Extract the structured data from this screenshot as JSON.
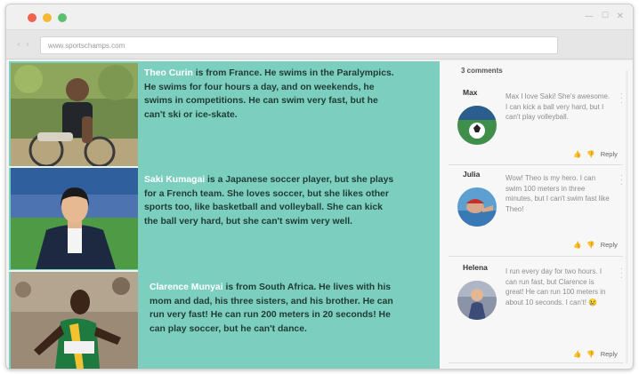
{
  "browser": {
    "url": "www.sportschamps.com",
    "nav_glyph": "‹ ›",
    "min_glyph": "—",
    "max_glyph": "☐",
    "close_glyph": "✕"
  },
  "athletes": [
    {
      "name": "Theo Curin",
      "bio": " is from France. He swims in the Paralympics. He swims for four hours a day, and on weekends, he swims in competitions. He can swim very fast, but he can't ski or ice-skate."
    },
    {
      "name": "Saki Kumagai",
      "bio": " is a Japanese soccer player, but she plays for a French team. She loves soccer, but she likes other sports too, like basketball and volleyball. She can kick the ball very hard, but she can't swim very well."
    },
    {
      "name": "Clarence Munyai",
      "bio": " is from South Africa. He lives with his mom and dad, his three sisters, and his brother. He can run very fast! He can run 200 meters in 20 seconds! He can play soccer, but he can't dance."
    }
  ],
  "comments_header": "3 comments",
  "comments": [
    {
      "author": "Max",
      "text": "Max I love Saki! She's awesome. I can kick a ball very hard, but I can't play volleyball.",
      "reply_label": "Reply"
    },
    {
      "author": "Julia",
      "text": "Wow! Theo is my hero. I can swim 100 meters in three minutes, but I can't swim fast like Theo!",
      "reply_label": "Reply"
    },
    {
      "author": "Helena",
      "text": "I run every day for two hours. I can run fast, but Clarence is great! He can run 100 meters in about 10 seconds. I can't! 😢",
      "reply_label": "Reply"
    }
  ],
  "colors": {
    "panel_teal": "#7ccfbf",
    "name_highlight": "#ffffff",
    "body_text": "#1f3b34"
  },
  "icons": {
    "like": "thumbs-up-icon",
    "dislike": "thumbs-down-icon",
    "more": "kebab-menu-icon"
  }
}
